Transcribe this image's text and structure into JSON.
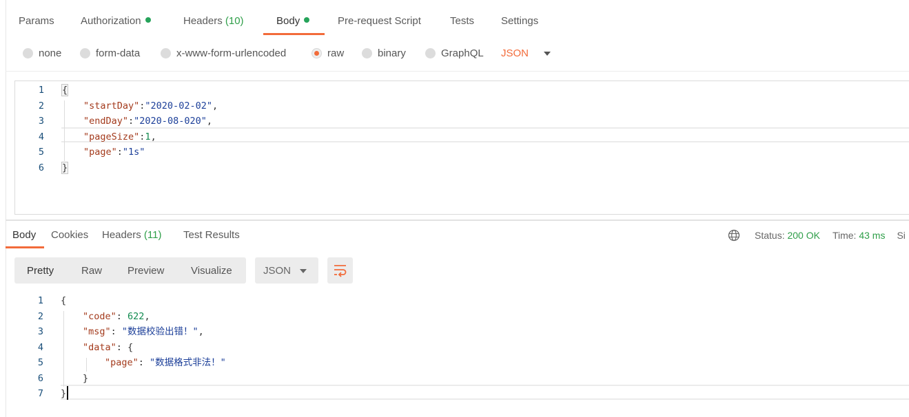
{
  "request_tabs": [
    {
      "label": "Params"
    },
    {
      "label": "Authorization",
      "dot": true
    },
    {
      "label": "Headers",
      "count": "(10)"
    },
    {
      "label": "Body",
      "dot": true,
      "active": true
    },
    {
      "label": "Pre-request Script"
    },
    {
      "label": "Tests"
    },
    {
      "label": "Settings"
    }
  ],
  "body_modes": [
    {
      "label": "none"
    },
    {
      "label": "form-data"
    },
    {
      "label": "x-www-form-urlencoded"
    },
    {
      "label": "raw",
      "selected": true
    },
    {
      "label": "binary"
    },
    {
      "label": "GraphQL"
    }
  ],
  "language_select": {
    "value": "JSON"
  },
  "request_body": {
    "line_numbers": [
      "1",
      "2",
      "3",
      "4",
      "5",
      "6"
    ],
    "lines": [
      [
        {
          "t": "{",
          "c": "punc"
        }
      ],
      [
        {
          "t": "\"startDay\"",
          "c": "key"
        },
        {
          "t": ":",
          "c": "punc"
        },
        {
          "t": "\"2020-02-02\"",
          "c": "str"
        },
        {
          "t": ",",
          "c": "punc"
        }
      ],
      [
        {
          "t": "\"endDay\"",
          "c": "key"
        },
        {
          "t": ":",
          "c": "punc"
        },
        {
          "t": "\"2020-08-020\"",
          "c": "str"
        },
        {
          "t": ",",
          "c": "punc"
        }
      ],
      [
        {
          "t": "\"pageSize\"",
          "c": "key"
        },
        {
          "t": ":",
          "c": "punc"
        },
        {
          "t": "1",
          "c": "num"
        },
        {
          "t": ",",
          "c": "punc"
        }
      ],
      [
        {
          "t": "\"page\"",
          "c": "key"
        },
        {
          "t": ":",
          "c": "punc"
        },
        {
          "t": "\"1s\"",
          "c": "str"
        }
      ],
      [
        {
          "t": "}",
          "c": "punc"
        }
      ]
    ]
  },
  "response_tabs": [
    {
      "label": "Body",
      "active": true
    },
    {
      "label": "Cookies"
    },
    {
      "label": "Headers",
      "count": "(11)"
    },
    {
      "label": "Test Results"
    }
  ],
  "status": {
    "status_label": "Status:",
    "status_value": "200 OK",
    "time_label": "Time:",
    "time_value": "43 ms",
    "size_label_partial": "Si"
  },
  "view_modes": [
    {
      "label": "Pretty",
      "active": true
    },
    {
      "label": "Raw"
    },
    {
      "label": "Preview"
    },
    {
      "label": "Visualize"
    }
  ],
  "response_format": {
    "value": "JSON"
  },
  "response_body": {
    "line_numbers": [
      "1",
      "2",
      "3",
      "4",
      "5",
      "6",
      "7"
    ],
    "lines": [
      [
        {
          "t": "{",
          "c": "punc"
        }
      ],
      [
        {
          "t": "\"code\"",
          "c": "key"
        },
        {
          "t": ": ",
          "c": "punc"
        },
        {
          "t": "622",
          "c": "num"
        },
        {
          "t": ",",
          "c": "punc"
        }
      ],
      [
        {
          "t": "\"msg\"",
          "c": "key"
        },
        {
          "t": ": ",
          "c": "punc"
        },
        {
          "t": "\"数据校验出错！\"",
          "c": "str"
        },
        {
          "t": ",",
          "c": "punc"
        }
      ],
      [
        {
          "t": "\"data\"",
          "c": "key"
        },
        {
          "t": ": {",
          "c": "punc"
        }
      ],
      [
        {
          "t": "\"page\"",
          "c": "key"
        },
        {
          "t": ": ",
          "c": "punc"
        },
        {
          "t": "\"数据格式非法！\"",
          "c": "str"
        }
      ],
      [
        {
          "t": "}",
          "c": "punc"
        }
      ],
      [
        {
          "t": "}",
          "c": "punc"
        }
      ]
    ]
  },
  "colors": {
    "accent": "#f26b3a",
    "success": "#2e9e48"
  }
}
